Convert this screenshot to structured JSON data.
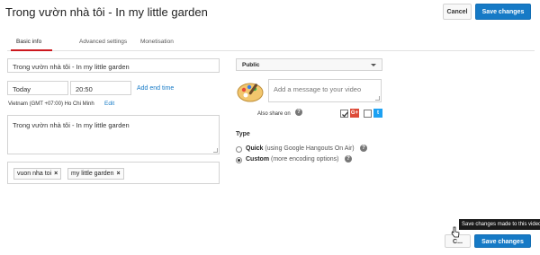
{
  "header": {
    "title": "Trong vườn nhà tôi - In my little garden",
    "cancel_label": "Cancel",
    "save_label": "Save changes"
  },
  "tabs": [
    {
      "label": "Basic info",
      "active": true
    },
    {
      "label": "Advanced settings",
      "active": false
    },
    {
      "label": "Monetisation",
      "active": false
    }
  ],
  "form": {
    "title_value": "Trong vườn nhà tôi - In my little garden",
    "date_value": "Today",
    "time_value": "20:50",
    "add_end_time": "Add end time",
    "timezone": "Vietnam (GMT +07:00) Ho Chi Minh",
    "edit_label": "Edit",
    "description_value": "Trong vườn nhà tôi - In my little garden",
    "tags": [
      "vuon nha toi",
      "my little garden"
    ]
  },
  "side": {
    "privacy_value": "Public",
    "message_placeholder": "Add a message to your video",
    "also_share_on": "Also share on",
    "type_heading": "Type",
    "quick_label": "Quick",
    "quick_note": "(using Google Hangouts On Air)",
    "custom_label": "Custom",
    "custom_note": "(more encoding options)"
  },
  "footer": {
    "cancel_label": "C...",
    "save_label": "Save changes",
    "tooltip": "Save changes made to this video"
  },
  "colors": {
    "accent_blue": "#167ac6",
    "tab_red": "#cc181e",
    "google_plus": "#dd4b39",
    "twitter": "#1da1f2"
  }
}
